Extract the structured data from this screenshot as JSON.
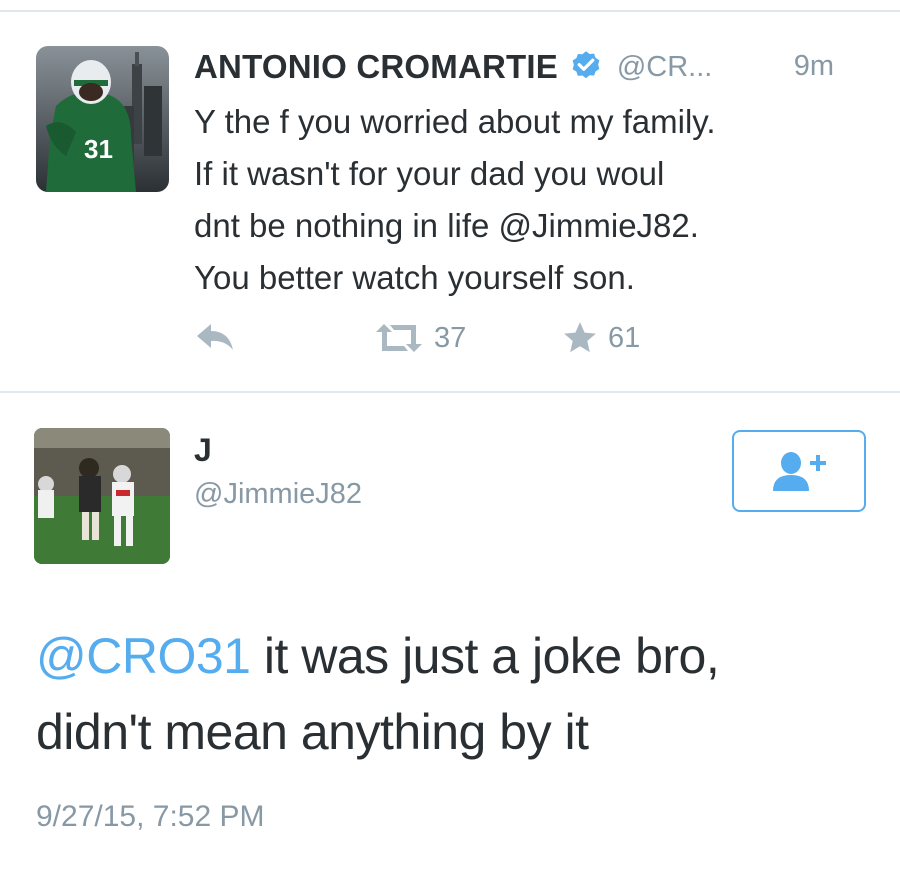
{
  "tweet1": {
    "author_name": "ANTONIO CROMARTIE",
    "author_handle": "@CR...",
    "time": "9m",
    "text_lines": [
      "Y the f you worried about my family.",
      "If it wasn't for your dad you woul",
      "dnt be nothing in life @JimmieJ82.",
      "You better watch yourself son."
    ],
    "retweet_count": "37",
    "favorite_count": "61",
    "icons": {
      "verified": "verified-badge-icon",
      "reply": "reply-icon",
      "retweet": "retweet-icon",
      "favorite": "star-icon"
    }
  },
  "tweet2": {
    "author_name": "J",
    "author_handle": "@JimmieJ82",
    "mention": "@CRO31",
    "text_rest": " it was just a joke bro,",
    "text_line2": "didn't mean anything by it",
    "date": "9/27/15, 7:52 PM",
    "icons": {
      "follow": "follow-user-icon"
    }
  },
  "colors": {
    "accent": "#55acee",
    "muted": "#8899a6",
    "text": "#292f33",
    "divider": "#e1e8ed"
  }
}
